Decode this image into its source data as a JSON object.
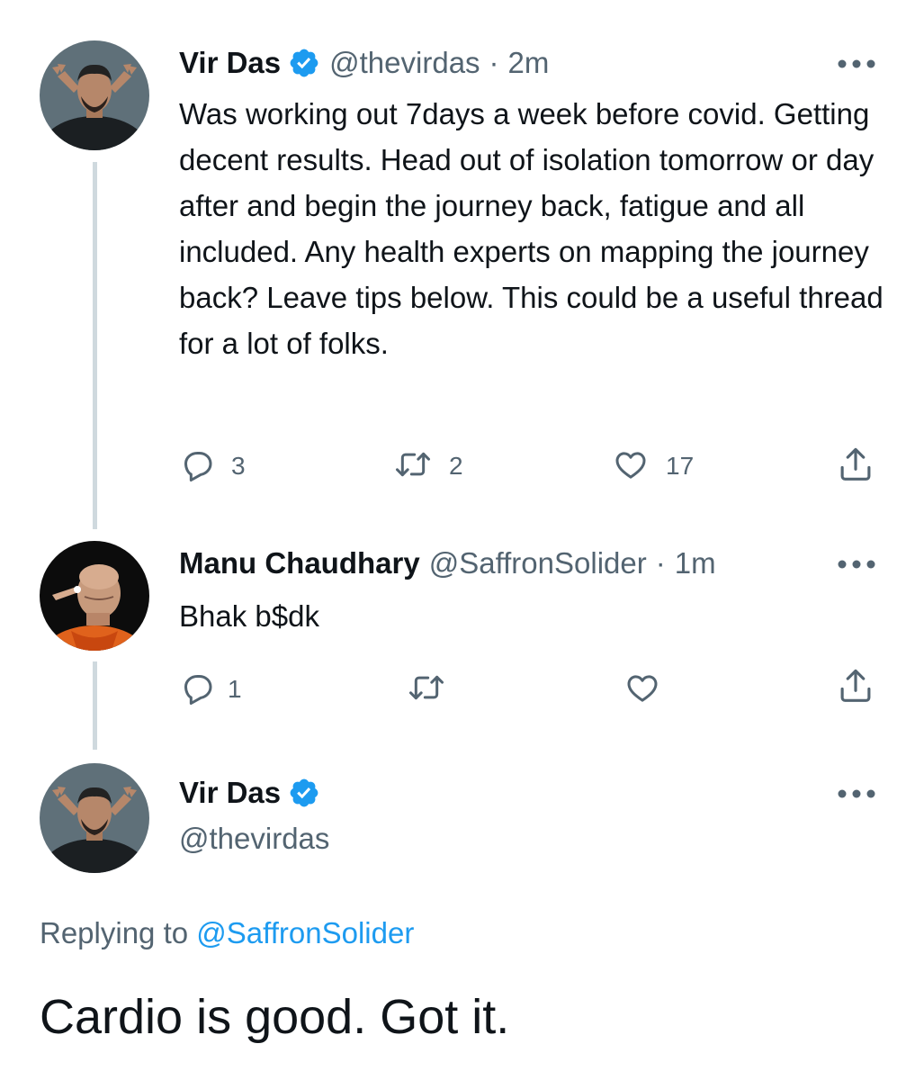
{
  "thread": {
    "tweets": [
      {
        "author_name": "Vir Das",
        "author_handle": "@thevirdas",
        "separator": "·",
        "time": "2m",
        "verified": true,
        "text": "Was working out 7days a week before covid. Getting decent results. Head out of isolation tomorrow or day after and begin the journey back, fatigue and all included. Any health experts on mapping the journey back? Leave tips below. This could be a useful thread for a lot of folks.",
        "reply_count": "3",
        "retweet_count": "2",
        "like_count": "17"
      },
      {
        "author_name": "Manu Chaudhary",
        "author_handle": "@SaffronSolider",
        "separator": "·",
        "time": "1m",
        "verified": false,
        "text": "Bhak b$dk",
        "reply_count": "1",
        "retweet_count": "",
        "like_count": ""
      }
    ]
  },
  "focused_tweet": {
    "author_name": "Vir Das",
    "author_handle": "@thevirdas",
    "verified": true,
    "replying_to_label": "Replying to",
    "replying_to_handle": "@SaffronSolider",
    "text": "Cardio is good. Got it."
  },
  "icons": {
    "reply": "reply-icon",
    "retweet": "retweet-icon",
    "like": "heart-icon",
    "share": "share-icon",
    "more": "more-icon",
    "verified": "verified-badge-icon"
  },
  "colors": {
    "verified_blue": "#1d9bf0",
    "secondary_text": "#536471",
    "thread_line": "#cfd9de",
    "link": "#1d9bf0"
  }
}
